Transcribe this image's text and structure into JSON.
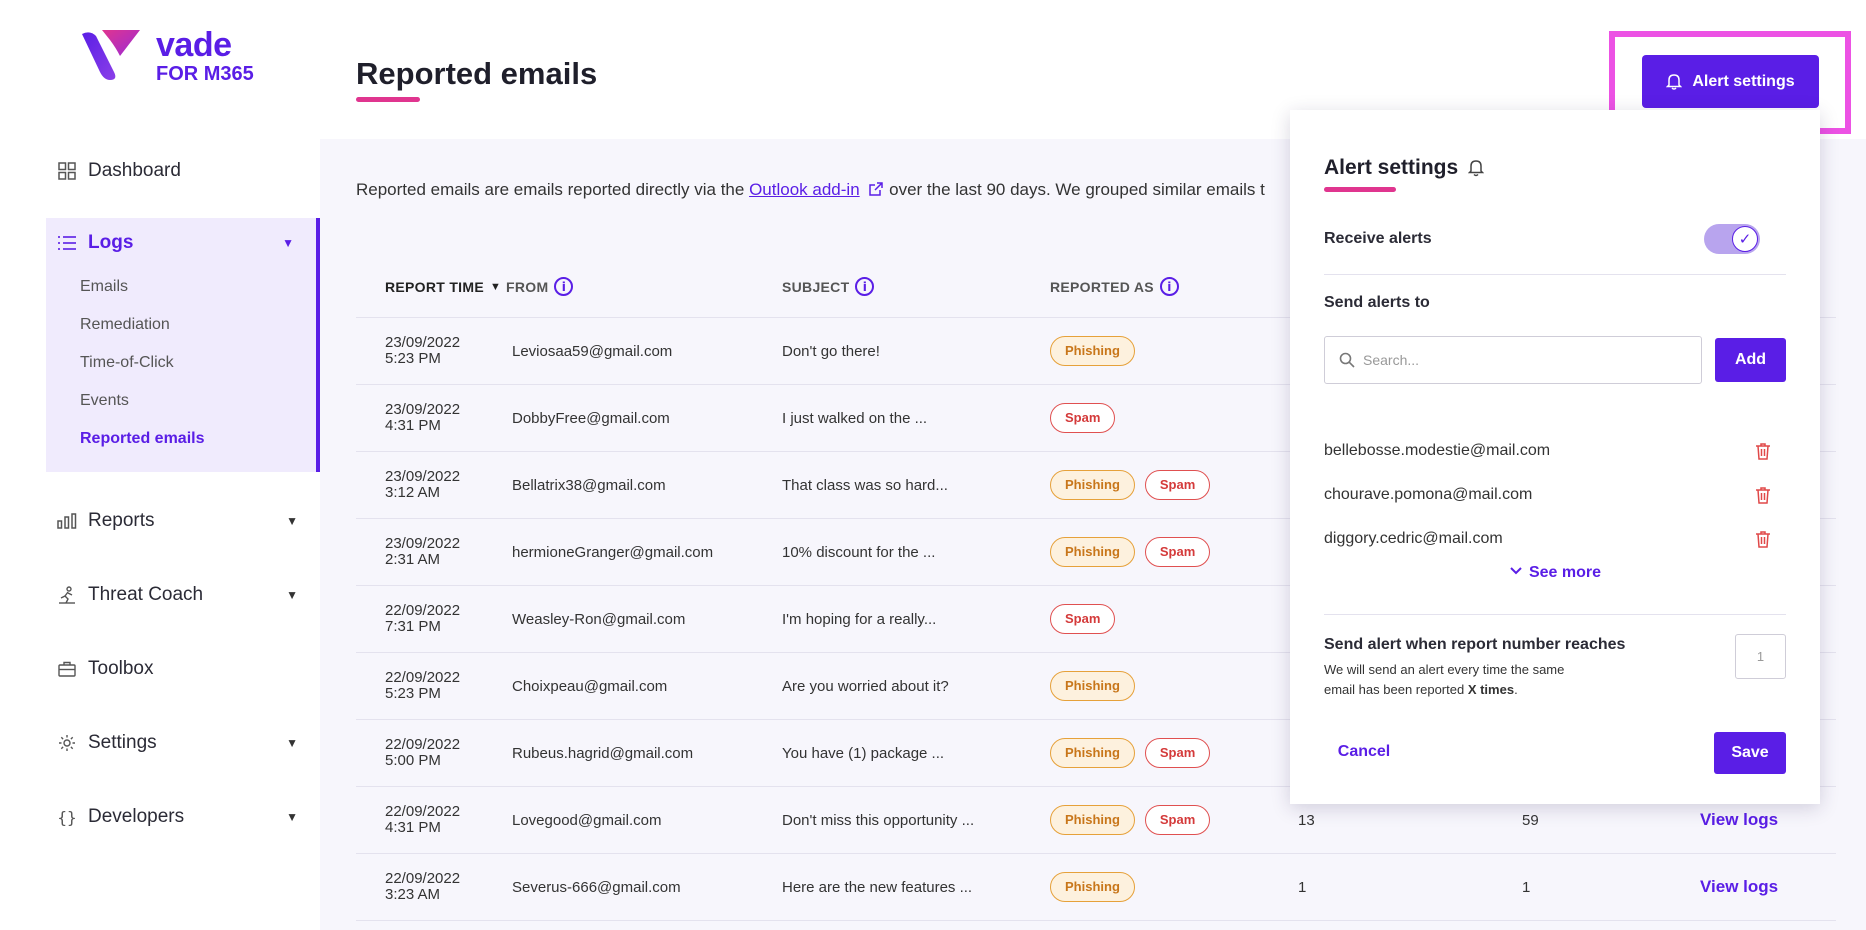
{
  "brand": {
    "name": "vade",
    "product": "FOR M365",
    "logo_icon": "vade-logo-icon",
    "accent_color": "#5a1ee6",
    "highlight_color": "#e0358f"
  },
  "header": {
    "title": "Reported emails",
    "alert_button": "Alert settings"
  },
  "sidebar": {
    "dashboard": "Dashboard",
    "logs": {
      "label": "Logs",
      "items": [
        "Emails",
        "Remediation",
        "Time-of-Click",
        "Events",
        "Reported emails"
      ],
      "active": "Reported emails"
    },
    "reports": "Reports",
    "threat_coach": "Threat Coach",
    "toolbox": "Toolbox",
    "settings": "Settings",
    "developers": "Developers"
  },
  "intro": {
    "before": "Reported emails are emails reported directly via the ",
    "link": "Outlook add-in",
    "after": " over the last 90 days.  We grouped similar emails t"
  },
  "table": {
    "columns": [
      "REPORT TIME",
      "FROM",
      "SUBJECT",
      "REPORTED AS"
    ],
    "rows": [
      {
        "date": "23/09/2022",
        "time": "5:23 PM",
        "from": "Leviosaa59@gmail.com",
        "subject": "Don't go there!",
        "tags": [
          "Phishing"
        ],
        "n1": "",
        "n2": "",
        "action": ""
      },
      {
        "date": "23/09/2022",
        "time": "4:31 PM",
        "from": "DobbyFree@gmail.com",
        "subject": "I just walked on the ...",
        "tags": [
          "Spam"
        ],
        "n1": "",
        "n2": "",
        "action": ""
      },
      {
        "date": "23/09/2022",
        "time": "3:12 AM",
        "from": "Bellatrix38@gmail.com",
        "subject": "That class was so hard...",
        "tags": [
          "Phishing",
          "Spam"
        ],
        "n1": "",
        "n2": "",
        "action": ""
      },
      {
        "date": "23/09/2022",
        "time": "2:31 AM",
        "from": "hermioneGranger@gmail.com",
        "subject": "10% discount for the ...",
        "tags": [
          "Phishing",
          "Spam"
        ],
        "n1": "",
        "n2": "",
        "action": ""
      },
      {
        "date": "22/09/2022",
        "time": "7:31 PM",
        "from": "Weasley-Ron@gmail.com",
        "subject": "I'm hoping for a really...",
        "tags": [
          "Spam"
        ],
        "n1": "",
        "n2": "",
        "action": ""
      },
      {
        "date": "22/09/2022",
        "time": "5:23 PM",
        "from": "Choixpeau@gmail.com",
        "subject": "Are you worried about it?",
        "tags": [
          "Phishing"
        ],
        "n1": "",
        "n2": "",
        "action": ""
      },
      {
        "date": "22/09/2022",
        "time": "5:00 PM",
        "from": "Rubeus.hagrid@gmail.com",
        "subject": "You have (1) package ...",
        "tags": [
          "Phishing",
          "Spam"
        ],
        "n1": "",
        "n2": "",
        "action": ""
      },
      {
        "date": "22/09/2022",
        "time": "4:31 PM",
        "from": "Lovegood@gmail.com",
        "subject": "Don't miss this opportunity ...",
        "tags": [
          "Phishing",
          "Spam"
        ],
        "n1": "13",
        "n2": "59",
        "action": "View logs"
      },
      {
        "date": "22/09/2022",
        "time": "3:23 AM",
        "from": "Severus-666@gmail.com",
        "subject": "Here are the new features ...",
        "tags": [
          "Phishing"
        ],
        "n1": "1",
        "n2": "1",
        "action": "View logs"
      }
    ]
  },
  "panel": {
    "title": "Alert settings",
    "receive_alerts": "Receive alerts",
    "receive_alerts_on": true,
    "send_alerts_to": "Send alerts to",
    "search_placeholder": "Search...",
    "add_button": "Add",
    "recipients": [
      "bellebosse.modestie@mail.com",
      "chourave.pomona@mail.com",
      "diggory.cedric@mail.com"
    ],
    "see_more": "See more",
    "threshold_label": "Send alert when report number reaches",
    "threshold_desc_before": "We will send an alert every time the same email has been reported ",
    "threshold_desc_bold": "X times",
    "threshold_desc_after": ".",
    "threshold_value": "1",
    "cancel_button": "Cancel",
    "save_button": "Save"
  }
}
